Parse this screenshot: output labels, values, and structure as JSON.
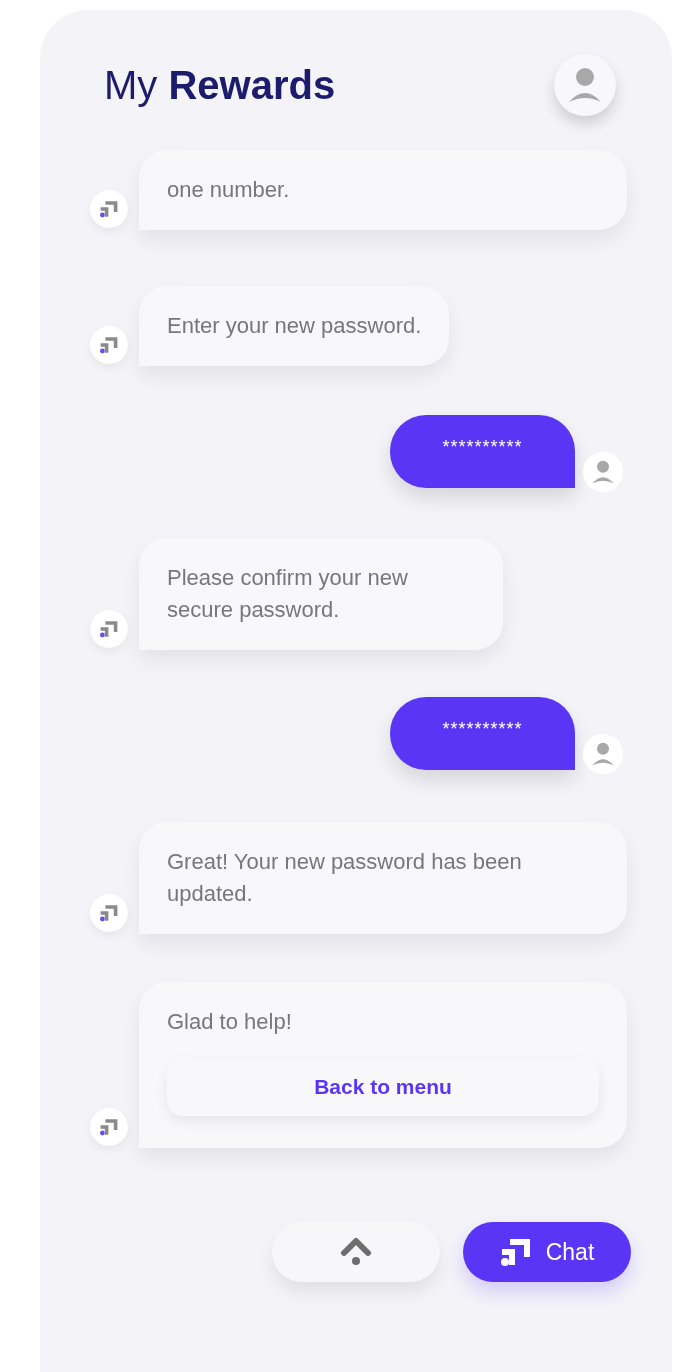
{
  "header": {
    "title": "My **Rewards**"
  },
  "messages": [
    {
      "kind": "bot",
      "text": "one number."
    },
    {
      "kind": "bot",
      "text": "Enter your new password."
    },
    {
      "kind": "user",
      "text": "**********"
    },
    {
      "kind": "bot",
      "text": "Please confirm your new secure password."
    },
    {
      "kind": "user",
      "text": "**********"
    },
    {
      "kind": "bot",
      "text": "Great! Your new password has been updated."
    },
    {
      "kind": "bot",
      "text": "Glad to help!",
      "button": "Back to menu"
    }
  ],
  "bottom_bar": {
    "chat_button": "Chat"
  }
}
